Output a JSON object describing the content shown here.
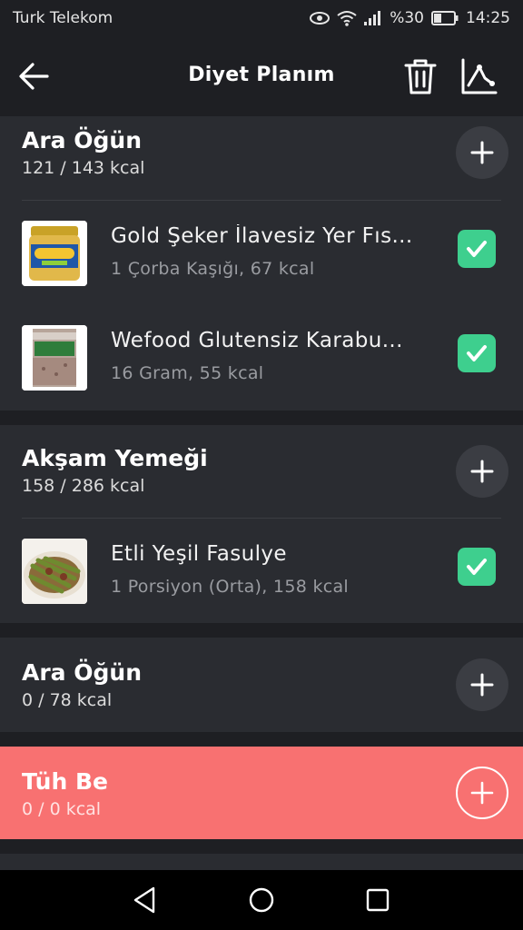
{
  "status_bar": {
    "carrier": "Turk Telekom",
    "battery": "%30",
    "time": "14:25"
  },
  "header": {
    "title": "Diyet Planım"
  },
  "meals": [
    {
      "title": "Ara Öğün",
      "kcal": "121 / 143 kcal",
      "items": [
        {
          "name": "Gold Şeker İlavesiz Yer Fıs...",
          "detail": "1 Çorba Kaşığı, 67 kcal",
          "checked": true
        },
        {
          "name": "Wefood Glutensiz Karabu...",
          "detail": "16 Gram, 55 kcal",
          "checked": true
        }
      ]
    },
    {
      "title": "Akşam Yemeği",
      "kcal": "158 / 286 kcal",
      "items": [
        {
          "name": "Etli Yeşil Fasulye",
          "detail": "1 Porsiyon (Orta), 158 kcal",
          "checked": true
        }
      ]
    },
    {
      "title": "Ara Öğün",
      "kcal": "0 / 78 kcal",
      "items": []
    },
    {
      "title": "Tüh Be",
      "kcal": "0 / 0 kcal",
      "items": [],
      "highlight_color": "#f87171"
    }
  ],
  "colors": {
    "background": "#1e1f23",
    "card": "#2a2c31",
    "check": "#3ecf8e",
    "highlight": "#f87171"
  }
}
